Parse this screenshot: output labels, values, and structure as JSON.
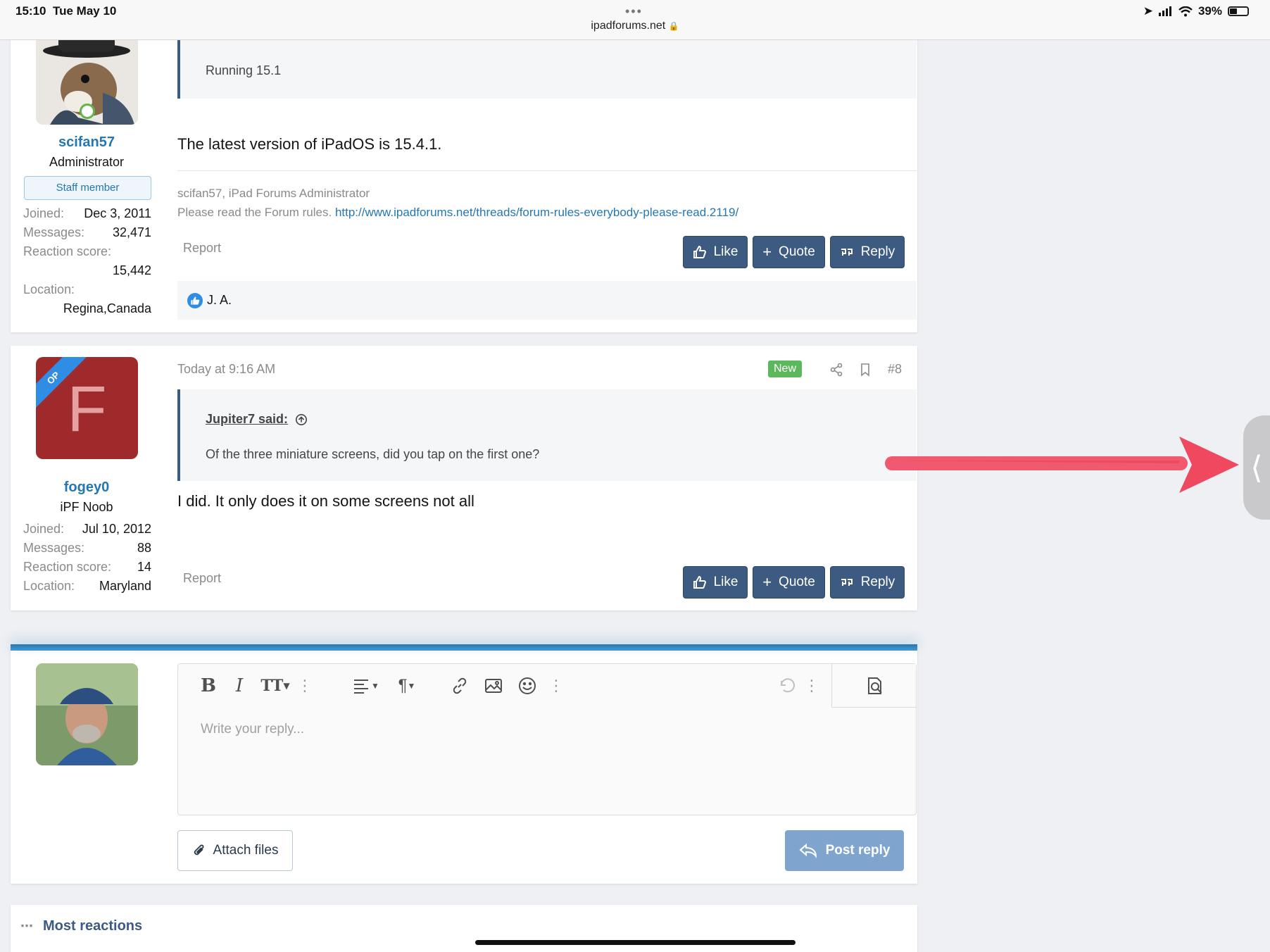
{
  "statusbar": {
    "time": "15:10",
    "date": "Tue May 10",
    "url": "ipadforums.net",
    "battery": "39%"
  },
  "post1": {
    "quote_text": "Running 15.1",
    "username": "scifan57",
    "user_title": "Administrator",
    "staff_badge": "Staff member",
    "stats": {
      "joined_label": "Joined:",
      "joined": "Dec 3, 2011",
      "messages_label": "Messages:",
      "messages": "32,471",
      "reaction_label": "Reaction score:",
      "reaction": "15,442",
      "location_label": "Location:",
      "location": "Regina,Canada"
    },
    "body": "The latest version of iPadOS is 15.4.1.",
    "signature_line1": "scifan57, iPad Forums Administrator",
    "signature_line2_prefix": "Please read the Forum rules.",
    "signature_link": "http://www.ipadforums.net/threads/forum-rules-everybody-please-read.2119/",
    "report": "Report",
    "like": "Like",
    "quote": "Quote",
    "reply": "Reply",
    "reactions_user": "J. A."
  },
  "post2": {
    "avatar_letter": "F",
    "op_ribbon": "OP",
    "username": "fogey0",
    "user_title": "iPF Noob",
    "stats": {
      "joined_label": "Joined:",
      "joined": "Jul 10, 2012",
      "messages_label": "Messages:",
      "messages": "88",
      "reaction_label": "Reaction score:",
      "reaction": "14",
      "location_label": "Location:",
      "location": "Maryland"
    },
    "date": "Today at 9:16 AM",
    "new_badge": "New",
    "post_number": "#8",
    "quote_author": "Jupiter7 said:",
    "quote_text": "Of the three miniature screens, did you tap on the first one?",
    "body": "I did. It only does it on some screens not all",
    "report": "Report",
    "like": "Like",
    "quote": "Quote",
    "reply": "Reply"
  },
  "reply_form": {
    "placeholder": "Write your reply...",
    "attach": "Attach files",
    "post_reply": "Post reply"
  },
  "most_reactions": "Most reactions",
  "colors": {
    "accent": "#2577b1",
    "button": "#3d5a80",
    "new_badge": "#5cb85c",
    "op_avatar": "#9e2a2b",
    "annotation_arrow": "#f0485f"
  }
}
